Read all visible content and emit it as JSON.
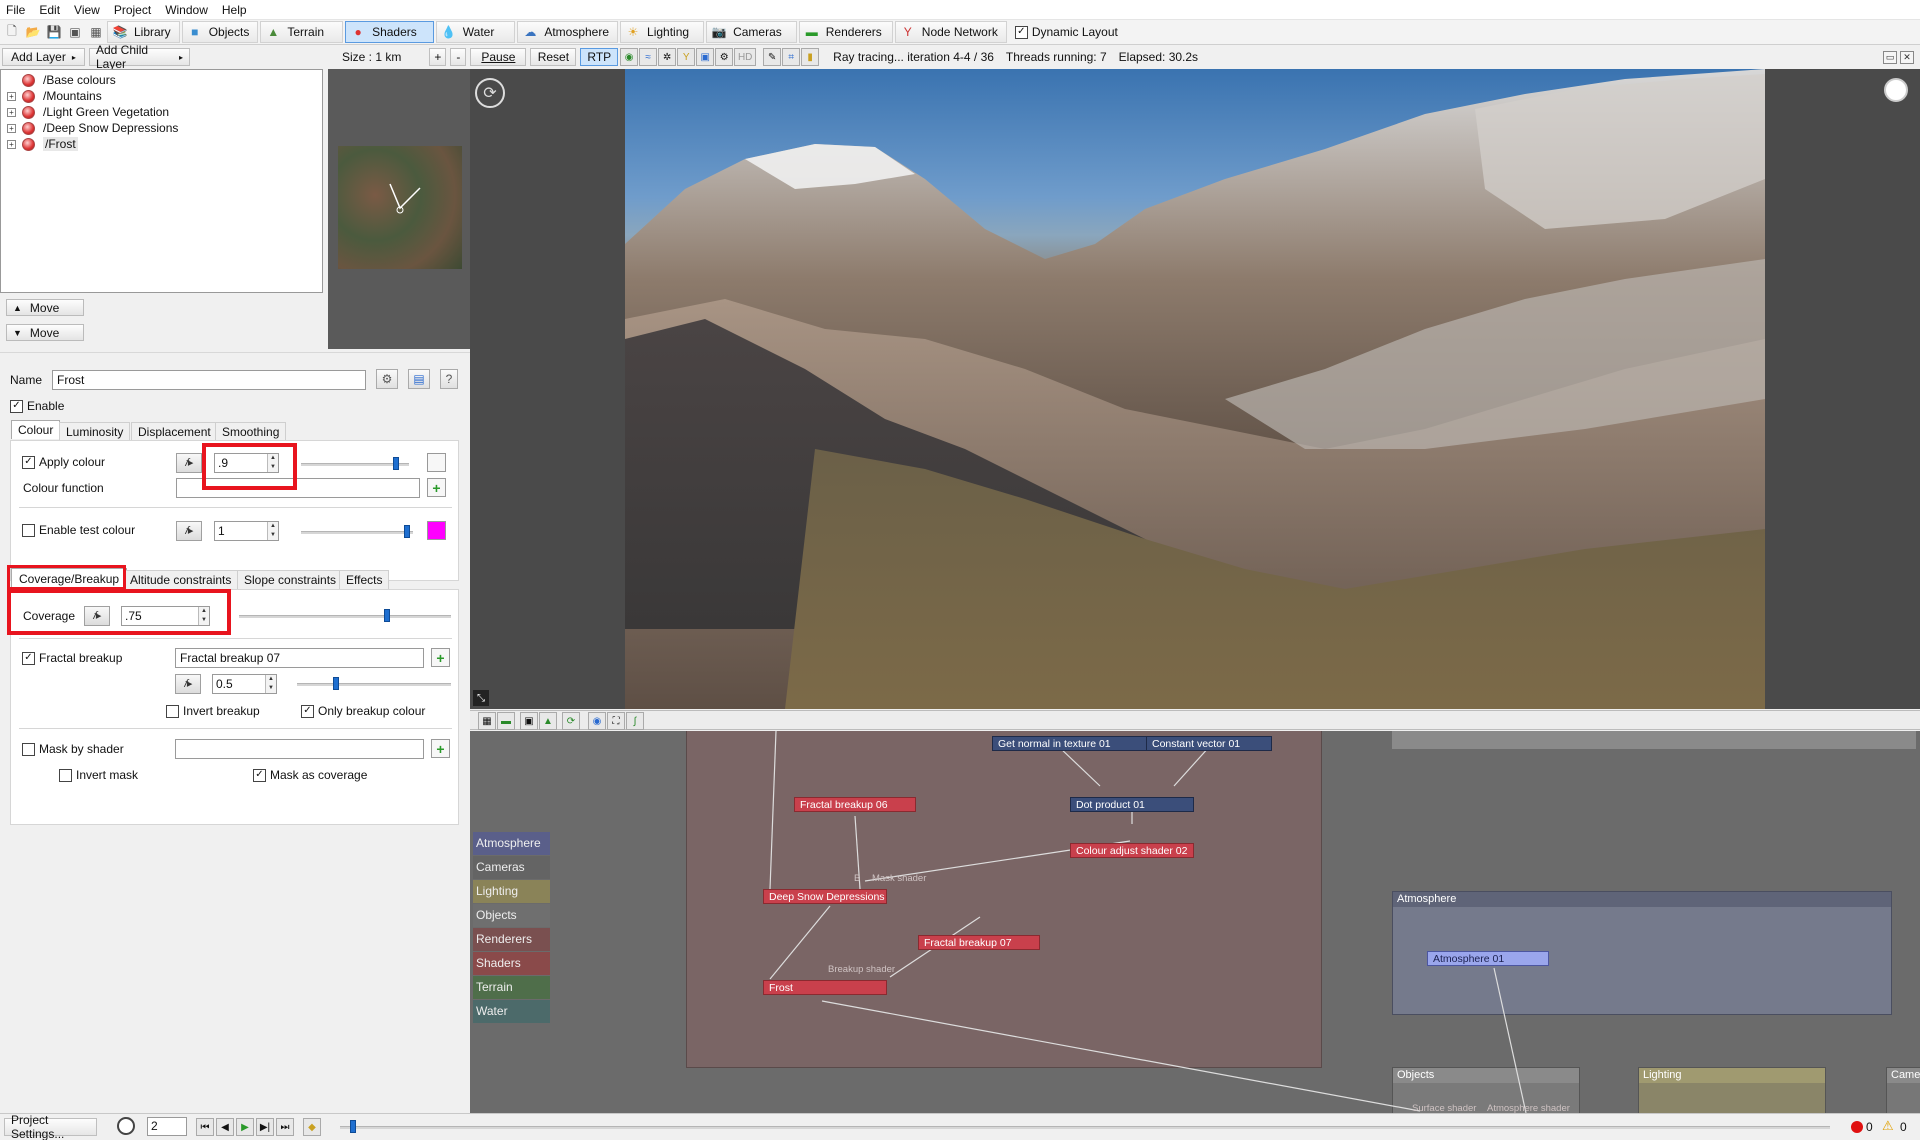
{
  "menu": [
    "File",
    "Edit",
    "View",
    "Project",
    "Window",
    "Help"
  ],
  "toolbar": {
    "buttons": [
      {
        "label": "Library",
        "icon": "books-icon"
      },
      {
        "label": "Objects",
        "icon": "cube-icon"
      },
      {
        "label": "Terrain",
        "icon": "terrain-icon"
      },
      {
        "label": "Shaders",
        "icon": "shader-sphere-icon",
        "active": true
      },
      {
        "label": "Water",
        "icon": "water-drop-icon"
      },
      {
        "label": "Atmosphere",
        "icon": "atmosphere-icon"
      },
      {
        "label": "Lighting",
        "icon": "sun-icon"
      },
      {
        "label": "Cameras",
        "icon": "camera-icon"
      },
      {
        "label": "Renderers",
        "icon": "renderer-icon"
      },
      {
        "label": "Node Network",
        "icon": "node-network-icon"
      }
    ],
    "dynamic_layout": "Dynamic Layout"
  },
  "subbar": {
    "add_layer": "Add Layer",
    "add_child_layer": "Add Child Layer",
    "size": "Size : 1 km",
    "plus": "+",
    "minus": "-",
    "pause": "Pause",
    "reset": "Reset",
    "rtp": "RTP",
    "hd": "HD",
    "status": "Ray tracing... iteration 4-4 / 36",
    "threads": "Threads running: 7",
    "elapsed": "Elapsed: 30.2s"
  },
  "layers": [
    "/Base colours",
    "/Mountains",
    "/Light Green Vegetation",
    "/Deep Snow Depressions",
    "/Frost"
  ],
  "move": {
    "up": "Move",
    "down": "Move"
  },
  "props": {
    "name_label": "Name",
    "name_value": "Frost",
    "enable": "Enable",
    "tabs": [
      "Colour",
      "Luminosity",
      "Displacement",
      "Smoothing"
    ],
    "apply_colour": "Apply colour",
    "apply_colour_value": ".9",
    "colour_function": "Colour function",
    "enable_test_colour": "Enable test colour",
    "test_colour_value": "1",
    "tabs2": [
      "Coverage/Breakup",
      "Altitude constraints",
      "Slope constraints",
      "Effects"
    ],
    "coverage": "Coverage",
    "coverage_value": ".75",
    "fractal_breakup": "Fractal breakup",
    "fractal_breakup_value": "Fractal breakup 07",
    "breakup_value": "0.5",
    "invert_breakup": "Invert breakup",
    "only_breakup_colour": "Only breakup colour",
    "mask_by_shader": "Mask by shader",
    "invert_mask": "Invert mask",
    "mask_as_coverage": "Mask as coverage"
  },
  "categories": [
    {
      "label": "Atmosphere",
      "color": "#5a5f8a"
    },
    {
      "label": "Cameras",
      "color": "#646464"
    },
    {
      "label": "Lighting",
      "color": "#8a8358"
    },
    {
      "label": "Objects",
      "color": "#6f6f6f"
    },
    {
      "label": "Renderers",
      "color": "#7a5050"
    },
    {
      "label": "Shaders",
      "color": "#8a4a4a"
    },
    {
      "label": "Terrain",
      "color": "#4f6e4a"
    },
    {
      "label": "Water",
      "color": "#4c6a6a"
    }
  ],
  "nodes": {
    "get_normal": "Get normal in texture 01",
    "constant_vector": "Constant vector 01",
    "fractal_06": "Fractal breakup 06",
    "dot_product": "Dot product 01",
    "colour_adjust": "Colour adjust shader 02",
    "deep_snow": "Deep Snow Depressions",
    "fractal_07": "Fractal breakup 07",
    "frost": "Frost",
    "atmosphere_01": "Atmosphere 01",
    "b_label": "B",
    "mask_shader_label": "Mask shader",
    "breakup_shader_label": "Breakup shader",
    "surface_shader_label": "Surface shader",
    "atmosphere_shader_label": "Atmosphere shader"
  },
  "groups": {
    "atmosphere": "Atmosphere",
    "objects": "Objects",
    "lighting": "Lighting",
    "cameras": "Came"
  },
  "statusbar": {
    "project_settings": "Project Settings...",
    "frame": "2",
    "errors": "0",
    "warnings": "0"
  }
}
